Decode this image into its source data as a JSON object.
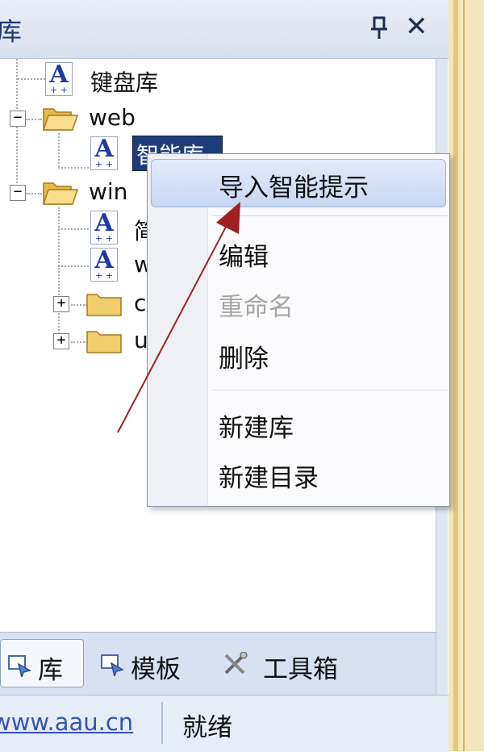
{
  "panel": {
    "title": "库"
  },
  "tree": {
    "nodes": [
      {
        "label": "键盘库"
      },
      {
        "label": "web"
      },
      {
        "label": "智能库"
      },
      {
        "label": "win"
      },
      {
        "label": "简"
      },
      {
        "label": "w"
      },
      {
        "label": "c"
      },
      {
        "label": "u"
      }
    ]
  },
  "context_menu": {
    "items": [
      {
        "label": "导入智能提示"
      },
      {
        "label": "编辑"
      },
      {
        "label": "重命名"
      },
      {
        "label": "删除"
      },
      {
        "label": "新建库"
      },
      {
        "label": "新建目录"
      }
    ]
  },
  "tabs": [
    {
      "label": "库"
    },
    {
      "label": "模板"
    },
    {
      "label": "工具箱"
    }
  ],
  "status_bar": {
    "link": "www.aau.cn",
    "status": "就绪"
  },
  "colors": {
    "selection": "#1c3c7a",
    "menu_highlight": "#c7d7f3",
    "arrow": "#a02020",
    "link": "#3255b8"
  }
}
